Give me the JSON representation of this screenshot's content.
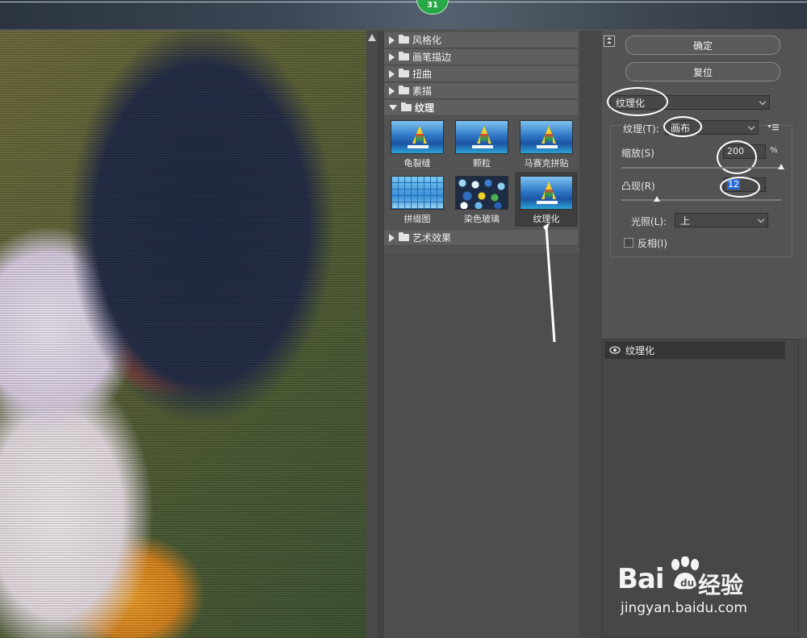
{
  "top_badge": "31",
  "gallery": {
    "categories": [
      {
        "label": "风格化",
        "open": false
      },
      {
        "label": "画笔描边",
        "open": false
      },
      {
        "label": "扭曲",
        "open": false
      },
      {
        "label": "素描",
        "open": false
      },
      {
        "label": "纹理",
        "open": true
      },
      {
        "label": "艺术效果",
        "open": false
      }
    ],
    "texture_filters": [
      {
        "label": "龟裂缝",
        "selected": false
      },
      {
        "label": "颗粒",
        "selected": false
      },
      {
        "label": "马赛克拼贴",
        "selected": false
      },
      {
        "label": "拼缀图",
        "selected": false
      },
      {
        "label": "染色玻璃",
        "selected": false
      },
      {
        "label": "纹理化",
        "selected": true
      }
    ]
  },
  "buttons": {
    "ok": "确定",
    "reset": "复位"
  },
  "settings": {
    "filter_select": "纹理化",
    "texture_label": "纹理(T):",
    "texture_value": "画布",
    "scale_label": "缩放(S)",
    "scale_value": "200",
    "scale_unit": "%",
    "scale_level": 200,
    "relief_label": "凸现(R)",
    "relief_value": "12",
    "relief_level": 12,
    "light_label": "光照(L):",
    "light_value": "上",
    "invert_label": "反相(I)",
    "invert_checked": false
  },
  "layers": {
    "items": [
      {
        "label": "纹理化",
        "visible": true
      }
    ]
  },
  "watermark": {
    "brand": "Bai",
    "cn": "经验",
    "url": "jingyan.baidu.com"
  },
  "colors": {
    "panel_bg": "#535353",
    "dark_bg": "#474747",
    "annotation": "#ffffff",
    "badge": "#27a745"
  }
}
